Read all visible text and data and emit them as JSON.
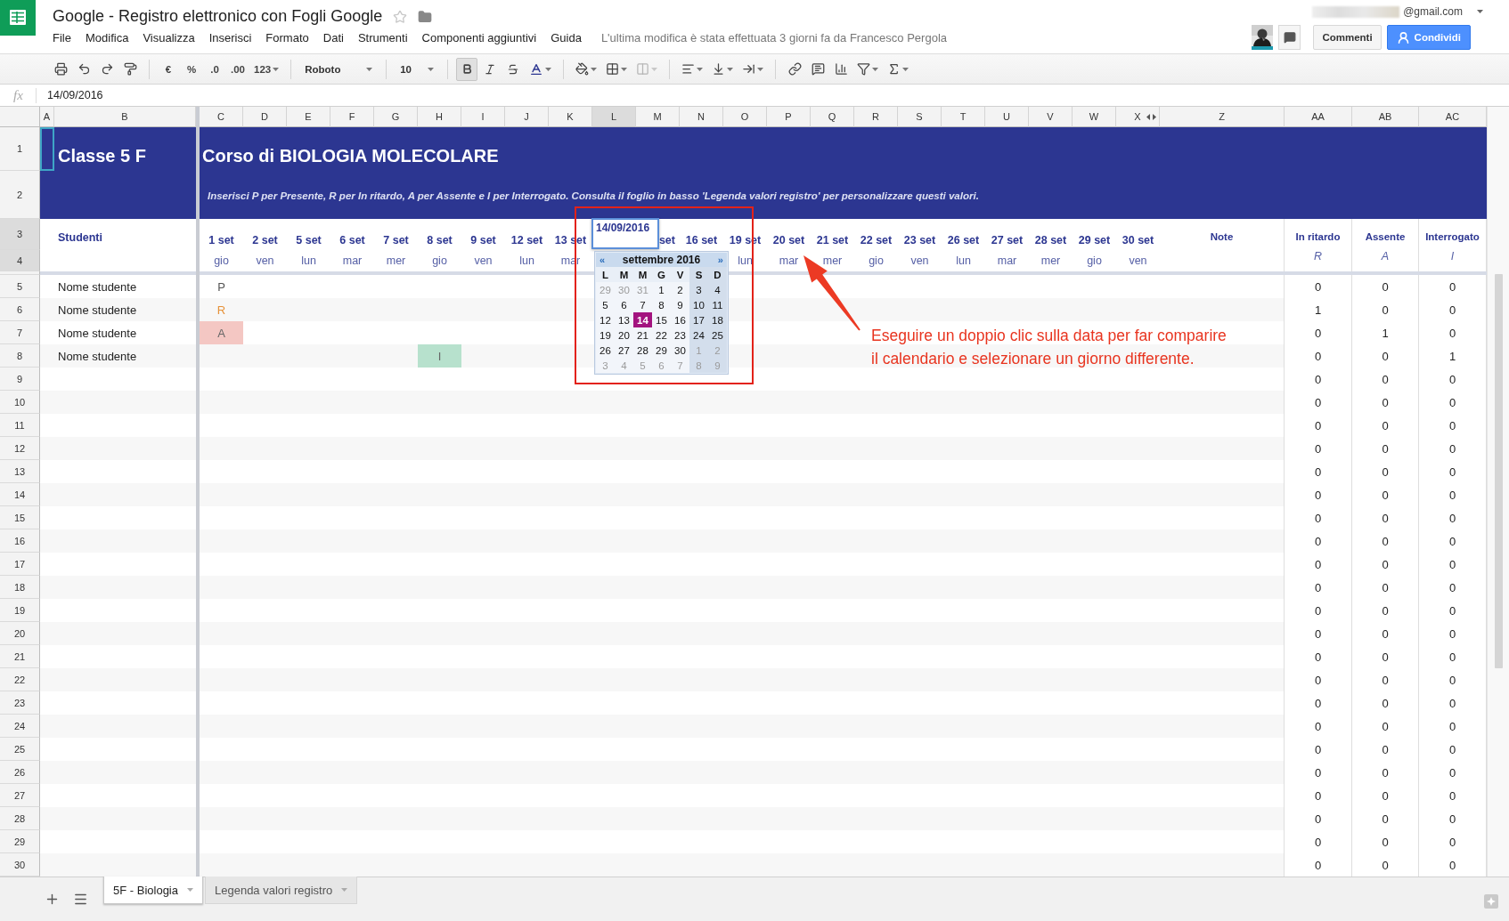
{
  "document": {
    "title": "Google - Registro elettronico con Fogli Google",
    "starred": false
  },
  "menu": [
    "File",
    "Modifica",
    "Visualizza",
    "Inserisci",
    "Formato",
    "Dati",
    "Strumenti",
    "Componenti aggiuntivi",
    "Guida"
  ],
  "last_edit": "L'ultima modifica è stata effettuata 3 giorni fa da Francesco Pergola",
  "account": {
    "email": "@gmail.com"
  },
  "buttons": {
    "comments": "Commenti",
    "share": "Condividi"
  },
  "toolbar": {
    "currency": "€",
    "percent": "%",
    "decimals_less": ".0",
    "decimals_more": ".00",
    "format": "123",
    "font": "Roboto",
    "font_size": "10",
    "bold_pressed": true,
    "merge_disabled": true
  },
  "formula_bar": {
    "label": "fx",
    "value": "14/09/2016"
  },
  "columns": [
    {
      "letter": "A",
      "selected": false
    },
    {
      "letter": "B",
      "selected": false
    },
    {
      "letter": "C",
      "selected": false
    },
    {
      "letter": "D",
      "selected": false
    },
    {
      "letter": "E",
      "selected": false
    },
    {
      "letter": "F",
      "selected": false
    },
    {
      "letter": "G",
      "selected": false
    },
    {
      "letter": "H",
      "selected": false
    },
    {
      "letter": "I",
      "selected": false
    },
    {
      "letter": "J",
      "selected": false
    },
    {
      "letter": "K",
      "selected": false
    },
    {
      "letter": "L",
      "selected": true
    },
    {
      "letter": "M",
      "selected": false
    },
    {
      "letter": "N",
      "selected": false
    },
    {
      "letter": "O",
      "selected": false
    },
    {
      "letter": "P",
      "selected": false
    },
    {
      "letter": "Q",
      "selected": false
    },
    {
      "letter": "R",
      "selected": false
    },
    {
      "letter": "S",
      "selected": false
    },
    {
      "letter": "T",
      "selected": false
    },
    {
      "letter": "U",
      "selected": false
    },
    {
      "letter": "V",
      "selected": false
    },
    {
      "letter": "W",
      "selected": false
    },
    {
      "letter": "X",
      "selected": false
    },
    {
      "letter": "Z",
      "selected": false
    },
    {
      "letter": "AA",
      "selected": false
    },
    {
      "letter": "AB",
      "selected": false
    },
    {
      "letter": "AC",
      "selected": false
    }
  ],
  "row_headers": [
    {
      "label": "1",
      "selected": false
    },
    {
      "label": "2",
      "selected": false
    },
    {
      "label": "3",
      "selected": true
    },
    {
      "label": "4",
      "selected": true
    },
    {
      "label": "5",
      "selected": false
    },
    {
      "label": "6",
      "selected": false
    },
    {
      "label": "7",
      "selected": false
    },
    {
      "label": "8",
      "selected": false
    },
    {
      "label": "9",
      "selected": false
    },
    {
      "label": "10",
      "selected": false
    },
    {
      "label": "11",
      "selected": false
    },
    {
      "label": "12",
      "selected": false
    },
    {
      "label": "13",
      "selected": false
    },
    {
      "label": "14",
      "selected": false
    },
    {
      "label": "15",
      "selected": false
    },
    {
      "label": "16",
      "selected": false
    },
    {
      "label": "17",
      "selected": false
    },
    {
      "label": "18",
      "selected": false
    },
    {
      "label": "19",
      "selected": false
    },
    {
      "label": "20",
      "selected": false
    },
    {
      "label": "21",
      "selected": false
    },
    {
      "label": "22",
      "selected": false
    },
    {
      "label": "23",
      "selected": false
    },
    {
      "label": "24",
      "selected": false
    },
    {
      "label": "25",
      "selected": false
    },
    {
      "label": "26",
      "selected": false
    },
    {
      "label": "27",
      "selected": false
    },
    {
      "label": "28",
      "selected": false
    },
    {
      "label": "29",
      "selected": false
    },
    {
      "label": "30",
      "selected": false
    }
  ],
  "sheet": {
    "class_name": "Classe 5 F",
    "course_title": "Corso di BIOLOGIA MOLECOLARE",
    "instructions": "Inserisci P per Presente, R per In ritardo, A per Assente e I per Interrogato. Consulta il foglio in basso 'Legenda valori registro' per personalizzare questi valori.",
    "students_header": "Studenti",
    "dates": [
      {
        "kind": "full",
        "date": "1 set",
        "day": "gio"
      },
      {
        "kind": "full",
        "date": "2 set",
        "day": "ven"
      },
      {
        "kind": "full",
        "date": "5 set",
        "day": "lun"
      },
      {
        "kind": "full",
        "date": "6 set",
        "day": "mar"
      },
      {
        "kind": "full",
        "date": "7 set",
        "day": "mer"
      },
      {
        "kind": "full",
        "date": "8 set",
        "day": "gio"
      },
      {
        "kind": "full",
        "date": "9 set",
        "day": "ven"
      },
      {
        "kind": "full",
        "date": "12 set",
        "day": "lun"
      },
      {
        "kind": "full",
        "date": "13 set",
        "day": "mar"
      },
      {
        "kind": "covered"
      },
      {
        "kind": "tail",
        "date": "set"
      },
      {
        "kind": "full",
        "date": "16 set"
      },
      {
        "kind": "full",
        "date": "19 set",
        "day": "lun"
      },
      {
        "kind": "full",
        "date": "20 set",
        "day": "mar"
      },
      {
        "kind": "full",
        "date": "21 set",
        "day": "mer"
      },
      {
        "kind": "full",
        "date": "22 set",
        "day": "gio"
      },
      {
        "kind": "full",
        "date": "23 set",
        "day": "ven"
      },
      {
        "kind": "full",
        "date": "26 set",
        "day": "lun"
      },
      {
        "kind": "full",
        "date": "27 set",
        "day": "mar"
      },
      {
        "kind": "full",
        "date": "28 set",
        "day": "mer"
      },
      {
        "kind": "full",
        "date": "29 set",
        "day": "gio"
      },
      {
        "kind": "full",
        "date": "30 set",
        "day": "ven"
      }
    ],
    "note_header": "Note",
    "totals_headers": [
      {
        "label": "In ritardo",
        "code": "R"
      },
      {
        "label": "Assente",
        "code": "A"
      },
      {
        "label": "Interrogato",
        "code": "I"
      }
    ],
    "rows": [
      {
        "name": "Nome studente",
        "marks": [
          {
            "kind": "present",
            "text": "P"
          }
        ],
        "totals": [
          "0",
          "0",
          "0"
        ]
      },
      {
        "name": "Nome studente",
        "marks": [
          {
            "kind": "late",
            "text": "R"
          }
        ],
        "totals": [
          "1",
          "0",
          "0"
        ]
      },
      {
        "name": "Nome studente",
        "marks": [
          {
            "kind": "absent",
            "text": "A"
          }
        ],
        "totals": [
          "0",
          "1",
          "0"
        ]
      },
      {
        "name": "Nome studente",
        "marks": [
          {
            "kind": "blank"
          },
          {
            "kind": "blank"
          },
          {
            "kind": "blank"
          },
          {
            "kind": "blank"
          },
          {
            "kind": "blank"
          },
          {
            "kind": "questioned",
            "text": "I"
          }
        ],
        "totals": [
          "0",
          "0",
          "1"
        ]
      },
      {
        "totals": [
          "0",
          "0",
          "0"
        ]
      },
      {
        "totals": [
          "0",
          "0",
          "0"
        ]
      },
      {
        "totals": [
          "0",
          "0",
          "0"
        ]
      },
      {
        "totals": [
          "0",
          "0",
          "0"
        ]
      },
      {
        "totals": [
          "0",
          "0",
          "0"
        ]
      },
      {
        "totals": [
          "0",
          "0",
          "0"
        ]
      },
      {
        "totals": [
          "0",
          "0",
          "0"
        ]
      },
      {
        "totals": [
          "0",
          "0",
          "0"
        ]
      },
      {
        "totals": [
          "0",
          "0",
          "0"
        ]
      },
      {
        "totals": [
          "0",
          "0",
          "0"
        ]
      },
      {
        "totals": [
          "0",
          "0",
          "0"
        ]
      },
      {
        "totals": [
          "0",
          "0",
          "0"
        ]
      },
      {
        "totals": [
          "0",
          "0",
          "0"
        ]
      },
      {
        "totals": [
          "0",
          "0",
          "0"
        ]
      },
      {
        "totals": [
          "0",
          "0",
          "0"
        ]
      },
      {
        "totals": [
          "0",
          "0",
          "0"
        ]
      },
      {
        "totals": [
          "0",
          "0",
          "0"
        ]
      },
      {
        "totals": [
          "0",
          "0",
          "0"
        ]
      },
      {
        "totals": [
          "0",
          "0",
          "0"
        ]
      },
      {
        "totals": [
          "0",
          "0",
          "0"
        ]
      },
      {
        "totals": [
          "0",
          "0",
          "0"
        ]
      },
      {
        "totals": [
          "0",
          "0",
          "0"
        ]
      }
    ]
  },
  "cell_editor": {
    "value": "14/09/2016"
  },
  "calendar": {
    "prev": "«",
    "month": "settembre 2016",
    "next": "»",
    "weekdays": [
      "L",
      "M",
      "M",
      "G",
      "V",
      "S",
      "D"
    ],
    "weeks": [
      [
        {
          "day": "29",
          "muted": true,
          "selected": false
        },
        {
          "day": "30",
          "muted": true,
          "selected": false
        },
        {
          "day": "31",
          "muted": true,
          "selected": false
        },
        {
          "day": "1",
          "muted": false,
          "selected": false
        },
        {
          "day": "2",
          "muted": false,
          "selected": false
        },
        {
          "day": "3",
          "muted": false,
          "selected": false
        },
        {
          "day": "4",
          "muted": false,
          "selected": false
        }
      ],
      [
        {
          "day": "5",
          "muted": false,
          "selected": false
        },
        {
          "day": "6",
          "muted": false,
          "selected": false
        },
        {
          "day": "7",
          "muted": false,
          "selected": false
        },
        {
          "day": "8",
          "muted": false,
          "selected": false
        },
        {
          "day": "9",
          "muted": false,
          "selected": false
        },
        {
          "day": "10",
          "muted": false,
          "selected": false
        },
        {
          "day": "11",
          "muted": false,
          "selected": false
        }
      ],
      [
        {
          "day": "12",
          "muted": false,
          "selected": false
        },
        {
          "day": "13",
          "muted": false,
          "selected": false
        },
        {
          "day": "14",
          "muted": false,
          "selected": true
        },
        {
          "day": "15",
          "muted": false,
          "selected": false
        },
        {
          "day": "16",
          "muted": false,
          "selected": false
        },
        {
          "day": "17",
          "muted": false,
          "selected": false
        },
        {
          "day": "18",
          "muted": false,
          "selected": false
        }
      ],
      [
        {
          "day": "19",
          "muted": false,
          "selected": false
        },
        {
          "day": "20",
          "muted": false,
          "selected": false
        },
        {
          "day": "21",
          "muted": false,
          "selected": false
        },
        {
          "day": "22",
          "muted": false,
          "selected": false
        },
        {
          "day": "23",
          "muted": false,
          "selected": false
        },
        {
          "day": "24",
          "muted": false,
          "selected": false
        },
        {
          "day": "25",
          "muted": false,
          "selected": false
        }
      ],
      [
        {
          "day": "26",
          "muted": false,
          "selected": false
        },
        {
          "day": "27",
          "muted": false,
          "selected": false
        },
        {
          "day": "28",
          "muted": false,
          "selected": false
        },
        {
          "day": "29",
          "muted": false,
          "selected": false
        },
        {
          "day": "30",
          "muted": false,
          "selected": false
        },
        {
          "day": "1",
          "muted": true,
          "selected": false
        },
        {
          "day": "2",
          "muted": true,
          "selected": false
        }
      ],
      [
        {
          "day": "3",
          "muted": true,
          "selected": false
        },
        {
          "day": "4",
          "muted": true,
          "selected": false
        },
        {
          "day": "5",
          "muted": true,
          "selected": false
        },
        {
          "day": "6",
          "muted": true,
          "selected": false
        },
        {
          "day": "7",
          "muted": true,
          "selected": false
        },
        {
          "day": "8",
          "muted": true,
          "selected": false
        },
        {
          "day": "9",
          "muted": true,
          "selected": false
        }
      ]
    ]
  },
  "annotation": {
    "lines": [
      "Eseguire un doppio clic sulla data per far comparire",
      "il calendario e selezionare un giorno differente."
    ]
  },
  "sheet_tabs": [
    {
      "label": "5F - Biologia",
      "selected": true
    },
    {
      "label": "Legenda valori registro",
      "selected": false
    }
  ]
}
